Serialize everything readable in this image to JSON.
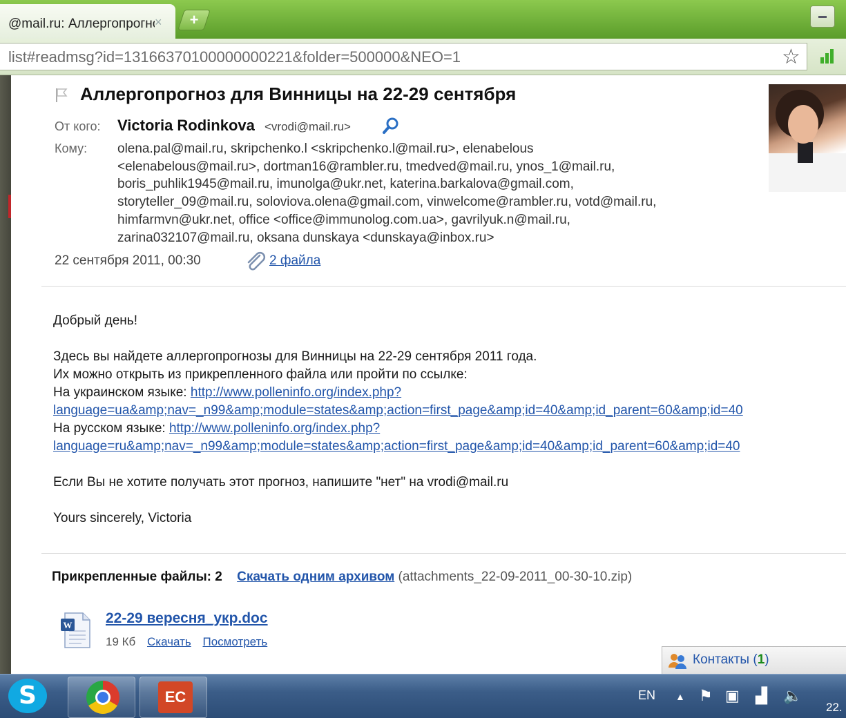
{
  "browser": {
    "tab_title": "@mail.ru: Аллергопрогноз",
    "tab_close": "×",
    "new_tab": "+",
    "url": "list#readmsg?id=13166370100000000221&folder=500000&NEO=1"
  },
  "message": {
    "subject": "Аллергопрогноз для Винницы на 22-29 сентября",
    "from_label": "От кого:",
    "from_name": "Victoria Rodinkova",
    "from_email": "<vrodi@mail.ru>",
    "to_label": "Кому:",
    "to_lines": [
      "olena.pal@mail.ru, skripchenko.l <skripchenko.l@mail.ru>, elenabelous",
      "<elenabelous@mail.ru>, dortman16@rambler.ru, tmedved@mail.ru, ynos_1@mail.ru,",
      "boris_puhlik1945@mail.ru, imunolga@ukr.net, katerina.barkalova@gmail.com,",
      "storyteller_09@mail.ru, soloviova.olena@gmail.com, vinwelcome@rambler.ru, votd@mail.ru,",
      "himfarmvn@ukr.net, office <office@immunolog.com.ua>, gavrilyuk.n@mail.ru,",
      "zarina032107@mail.ru, oksana dunskaya <dunskaya@inbox.ru>"
    ],
    "date": "22 сентября 2011, 00:30",
    "attachments_link": "2 файла",
    "body": {
      "greeting": "Добрый день!",
      "line1": "Здесь вы найдете аллергопрогнозы для Винницы на 22-29 сентября 2011 года.",
      "line2": "Их можно открыть из прикрепленного файла или пройти по ссылке:",
      "ua_label": "На украинском языке: ",
      "ua_link_1": "http://www.polleninfo.org/index.php?",
      "ua_link_2": "language=ua&amp;nav=_n99&amp;module=states&amp;action=first_page&amp;id=40&amp;id_parent=60&amp;id=40",
      "ru_label": "На русском языке: ",
      "ru_link_1": "http://www.polleninfo.org/index.php?",
      "ru_link_2": "language=ru&amp;nav=_n99&amp;module=states&amp;action=first_page&amp;id=40&amp;id_parent=60&amp;id=40",
      "unsubscribe": "Если Вы не хотите получать этот прогноз, напишите \"нет\" на vrodi@mail.ru",
      "signature": "Yours sincerely, Victoria"
    },
    "attachments": {
      "header": "Прикрепленные файлы: 2",
      "download_all": "Скачать одним архивом",
      "zip_name": "(attachments_22-09-2011_00-30-10.zip)",
      "file_name": "22-29 вересня_укр.doc",
      "file_size": "19 Кб",
      "download": "Скачать",
      "view": "Посмотреть"
    }
  },
  "contacts": {
    "label": "Контакты (",
    "count": "1",
    "close": ")"
  },
  "taskbar": {
    "skype_letter": "S",
    "ppt_label": "EC",
    "language": "EN",
    "clock": "22."
  },
  "colors": {
    "link": "#2255aa",
    "tabstrip": "#6fae37",
    "taskbar": "#3b5d88"
  }
}
